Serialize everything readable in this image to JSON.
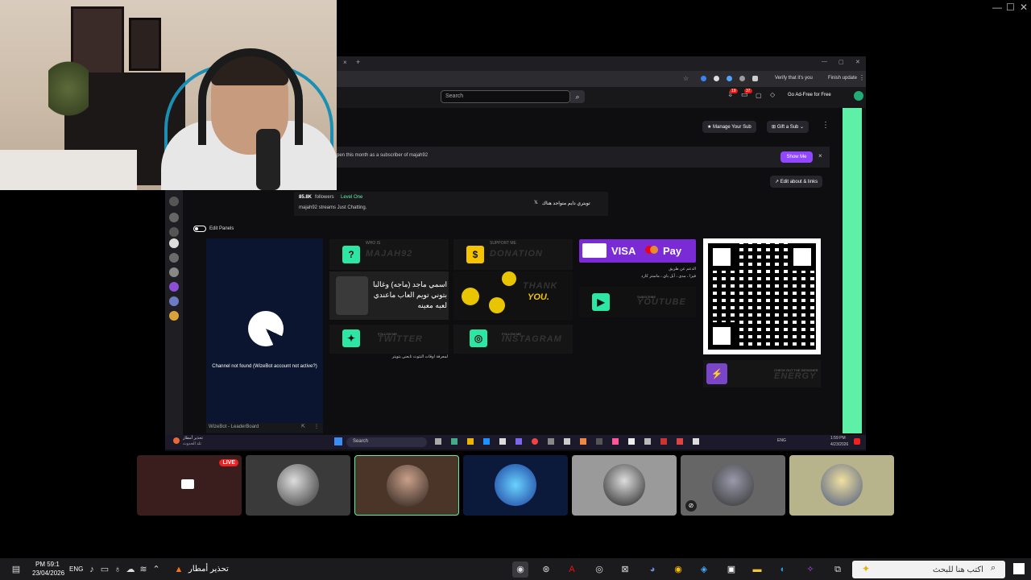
{
  "host": {
    "controls": [
      "—",
      "☐",
      "✕"
    ]
  },
  "browser": {
    "tab_close": "×",
    "tab_add": "+",
    "window_controls": [
      "—",
      "▢",
      "✕"
    ],
    "ext_verify": "Verify that it's you",
    "finish_update": "Finish update",
    "search_placeholder": "Search",
    "notif_count": "19",
    "whisper_count": "37",
    "go_ad_free": "Go Ad-Free for Free",
    "manage_sub": "Manage Your Sub",
    "gift_sub": "Gift a Sub",
    "banner_text": "pen this month as a subscriber of majah92",
    "show_me": "Show Me",
    "edit_about": "Edit about & links",
    "followers": "85.8K",
    "followers_label": "followers",
    "level": "Level One",
    "streams_line": "majah92 streams Just Chatting.",
    "twitter_line": "تويتري دايم متواجد هناك",
    "edit_panels": "Edit Panels",
    "wizebot_msg": "Channel not found (WizeBot account not active?)",
    "wizebot_footer": "WizeBot - LeaderBoard"
  },
  "panels": {
    "who": "MAJAH92",
    "donation": "DONATION",
    "arabic_intro": "اسمي ماجد (ماجه) وغالبا بتوني تويم العاب ماعندي لعبه معينه",
    "thank": "THANK",
    "you": "YOU.",
    "pay_visa": "VISA",
    "pay_apple": " Pay",
    "pay_text1": "الدعم عن طريق",
    "pay_text2": "فيزا ، مدى ، أبل باي ، ماستر كارد",
    "youtube": "YOUTUBE",
    "twitter": "TWITTER",
    "twitter_caption": "لمعرفة اوقات البثوث تابعني بتويتر",
    "instagram": "INSTAGRAM",
    "energy": "ENERGY",
    "designer": "CHECK OUT THE DESIGNER",
    "support_me": "SUPPORT ME",
    "who_is": "WHO IS",
    "follow_me": "FOLLOW ME",
    "subscribe": "SUBSCRIBE"
  },
  "inner_taskbar": {
    "weather": "تحذير أمطار",
    "weather_sub": "تلد الحدوث",
    "search": "Search",
    "time": "1:59 PM",
    "date": "4/23/2026",
    "lang": "ENG"
  },
  "call": {
    "live": "LIVE"
  },
  "taskbar": {
    "time": "PM 59:1",
    "date": "23/04/2026",
    "lang": "ENG",
    "weather": "تحذير أمطار",
    "search_placeholder": "اكتب هنا للبحث"
  },
  "colors": {
    "accent_green": "#5ef0a7",
    "twitch_purple": "#9147ff",
    "live_red": "#e22"
  }
}
